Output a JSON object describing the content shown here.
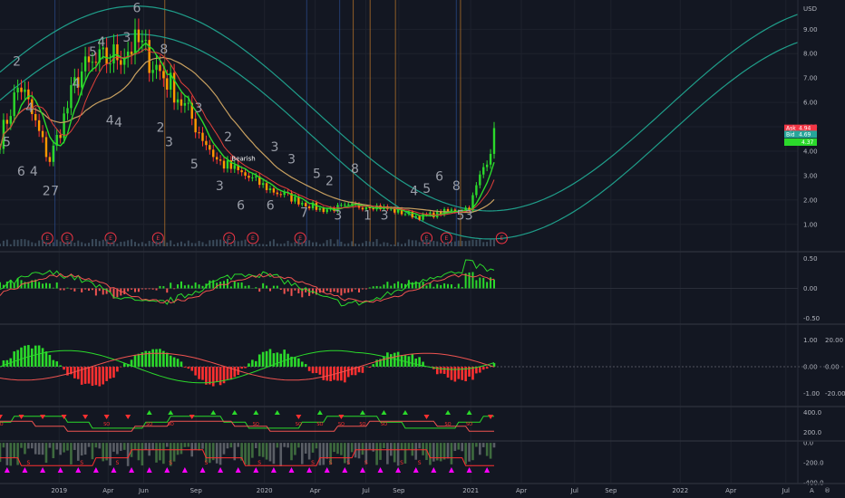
{
  "header": {
    "currency": "USD"
  },
  "colors": {
    "bg": "#131722",
    "grid": "#1e222d",
    "up": "#26a69a",
    "up_bright": "#2bd92b",
    "down": "#ef5350",
    "down_bright": "#ff3030",
    "orange": "#ff9800",
    "envelope": "#1f9e8a",
    "ma_slow": "#c8a060",
    "ma_fast": "#e0403a",
    "earn": "#f23645",
    "magenta": "#ff00ff"
  },
  "chart_data": [
    {
      "type": "line",
      "panel": "price",
      "price_axis_labels": [
        "9.00",
        "8.00",
        "7.00",
        "6.00",
        "5.00",
        "4.00",
        "3.00",
        "2.00",
        "1.00"
      ],
      "yvals": [
        9,
        8,
        7,
        6,
        5,
        4,
        3,
        2,
        1
      ],
      "ylim": [
        0.1,
        10.2
      ],
      "price_tags": [
        {
          "label": "Ask",
          "value": "4.94",
          "y": 4.94,
          "color": "#f23645"
        },
        {
          "label": "Bid",
          "value": "4.69",
          "y": 4.69,
          "color": "#26a69a"
        },
        {
          "label": "",
          "value": "4.37",
          "y": 4.37,
          "color": "#2bd92b"
        }
      ],
      "annotation": {
        "text": "Bearish",
        "x": 0.435,
        "y": 3.6
      },
      "earnings_marker": "E",
      "earnings_positions": [
        0.06,
        0.085,
        0.14,
        0.2,
        0.29,
        0.32,
        0.38,
        0.54,
        0.565,
        0.635
      ],
      "counts": [
        {
          "t": "2",
          "x": 0.02,
          "y": 7.5
        },
        {
          "t": "4",
          "x": 0.035,
          "y": 5.6
        },
        {
          "t": "5",
          "x": 0.008,
          "y": 4.2
        },
        {
          "t": "6",
          "x": 0.025,
          "y": 3.0
        },
        {
          "t": "4",
          "x": 0.04,
          "y": 3.0
        },
        {
          "t": "2",
          "x": 0.055,
          "y": 2.2
        },
        {
          "t": "7",
          "x": 0.065,
          "y": 2.2
        },
        {
          "t": "4",
          "x": 0.09,
          "y": 6.6
        },
        {
          "t": "5",
          "x": 0.11,
          "y": 7.9
        },
        {
          "t": "4",
          "x": 0.12,
          "y": 8.3
        },
        {
          "t": "4",
          "x": 0.13,
          "y": 5.1
        },
        {
          "t": "3",
          "x": 0.15,
          "y": 8.5
        },
        {
          "t": "6",
          "x": 0.162,
          "y": 9.7
        },
        {
          "t": "4",
          "x": 0.14,
          "y": 5.0
        },
        {
          "t": "8",
          "x": 0.194,
          "y": 8.0
        },
        {
          "t": "2",
          "x": 0.19,
          "y": 4.8
        },
        {
          "t": "3",
          "x": 0.2,
          "y": 4.2
        },
        {
          "t": "3",
          "x": 0.235,
          "y": 5.6
        },
        {
          "t": "5",
          "x": 0.23,
          "y": 3.3
        },
        {
          "t": "3",
          "x": 0.26,
          "y": 2.4
        },
        {
          "t": "2",
          "x": 0.27,
          "y": 4.4
        },
        {
          "t": "6",
          "x": 0.285,
          "y": 1.6
        },
        {
          "t": "3",
          "x": 0.325,
          "y": 4.0
        },
        {
          "t": "6",
          "x": 0.32,
          "y": 1.6
        },
        {
          "t": "3",
          "x": 0.345,
          "y": 3.5
        },
        {
          "t": "5",
          "x": 0.375,
          "y": 2.9
        },
        {
          "t": "7",
          "x": 0.36,
          "y": 1.3
        },
        {
          "t": "2",
          "x": 0.39,
          "y": 2.6
        },
        {
          "t": "8",
          "x": 0.42,
          "y": 3.1
        },
        {
          "t": "3",
          "x": 0.4,
          "y": 1.2
        },
        {
          "t": "1",
          "x": 0.435,
          "y": 1.2
        },
        {
          "t": "4",
          "x": 0.49,
          "y": 2.2
        },
        {
          "t": "5",
          "x": 0.505,
          "y": 2.3
        },
        {
          "t": "3",
          "x": 0.455,
          "y": 1.2
        },
        {
          "t": "6",
          "x": 0.52,
          "y": 2.8
        },
        {
          "t": "8",
          "x": 0.54,
          "y": 2.4
        },
        {
          "t": "5",
          "x": 0.545,
          "y": 1.2
        },
        {
          "t": "3",
          "x": 0.555,
          "y": 1.2
        }
      ]
    },
    {
      "type": "line",
      "panel": "oscillator",
      "axis_labels": [
        "0.50",
        "0.00",
        "-0.50"
      ],
      "yvals": [
        0.5,
        0.0,
        -0.5
      ],
      "ylim": [
        -0.55,
        0.55
      ]
    },
    {
      "type": "bar",
      "panel": "momentum",
      "axis_labels_left": [
        "1.00",
        "0.00",
        "-1.00"
      ],
      "yvals_left": [
        1.0,
        0.0,
        -1.0
      ],
      "axis_labels_right": [
        "20.00",
        "0.00",
        "-20.00"
      ],
      "yvals_right": [
        20,
        0,
        -20
      ],
      "ylim": [
        -1.45,
        1.45
      ]
    },
    {
      "type": "line",
      "panel": "signals",
      "axis_labels": [
        "400.0",
        "200.0"
      ],
      "yvals": [
        400,
        200
      ],
      "ylim": [
        120,
        440
      ],
      "signal_label": "SO"
    },
    {
      "type": "bar",
      "panel": "volume",
      "axis_labels": [
        "0.0",
        "-200.0",
        "-400.0"
      ],
      "yvals": [
        0,
        -200,
        -400
      ],
      "ylim": [
        -400,
        10
      ],
      "marker_label": "S"
    }
  ],
  "time_axis": {
    "labels": [
      "2019",
      "Apr",
      "Jun",
      "Sep",
      "2020",
      "Apr",
      "Jul",
      "Sep",
      "2021",
      "Apr",
      "Jul",
      "Sep",
      "2022",
      "Apr",
      "Jul"
    ],
    "positions": [
      0.07,
      0.128,
      0.17,
      0.232,
      0.313,
      0.373,
      0.433,
      0.472,
      0.557,
      0.617,
      0.68,
      0.723,
      0.805,
      0.865,
      0.93
    ]
  },
  "footer_buttons": {
    "auto": "A",
    "log": "®"
  }
}
